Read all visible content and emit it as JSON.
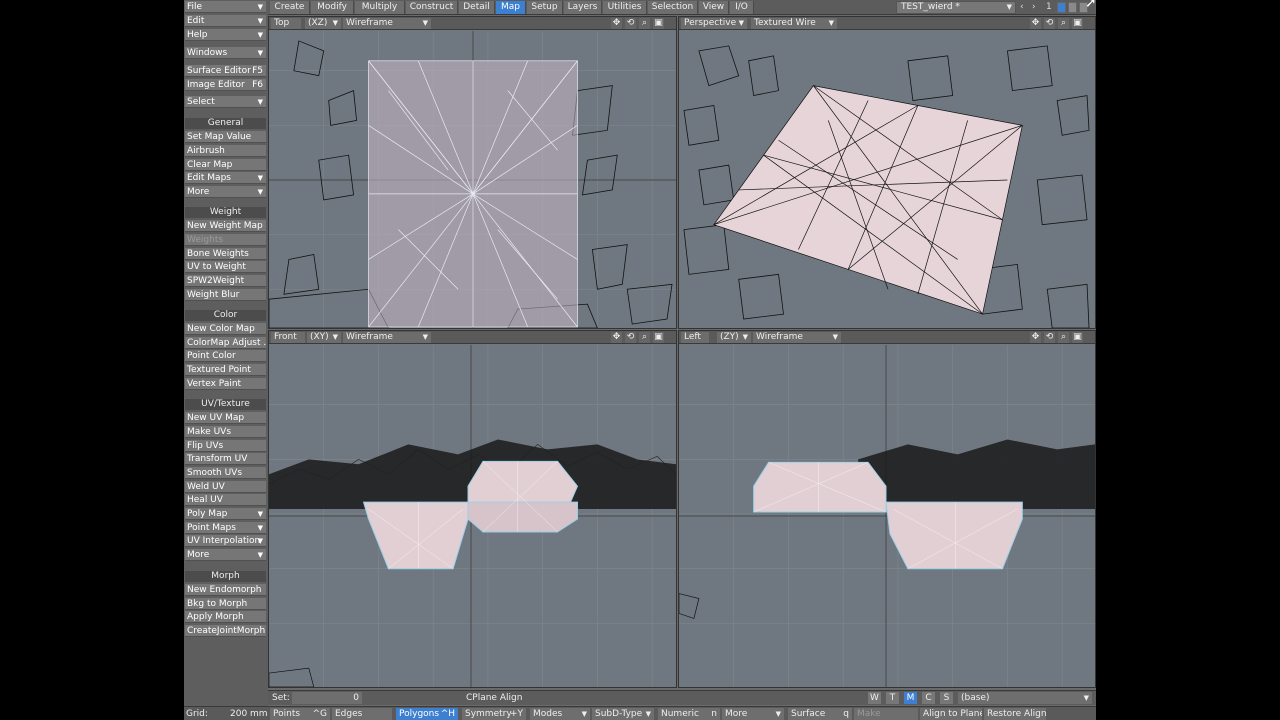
{
  "app": {
    "tabs": [
      "Create",
      "Modify",
      "Multiply",
      "Construct",
      "Detail",
      "Map",
      "Setup",
      "Layers",
      "Utilities",
      "Selection",
      "View",
      "I/O"
    ],
    "active_tab": "Map",
    "object_name": "TEST_wierd *",
    "layer_number": "1"
  },
  "sidebar": {
    "file": "File",
    "edit": "Edit",
    "help": "Help",
    "windows": "Windows",
    "surface_editor": "Surface Editor",
    "surface_editor_key": "F5",
    "image_editor": "Image Editor",
    "image_editor_key": "F6",
    "select": "Select",
    "general_header": "General",
    "set_map_value": "Set Map Value",
    "airbrush": "Airbrush",
    "clear_map": "Clear Map",
    "edit_maps": "Edit Maps",
    "more1": "More",
    "weight_header": "Weight",
    "new_weight_map": "New Weight Map",
    "weights": "Weights",
    "bone_weights": "Bone Weights",
    "uv_to_weight": "UV to Weight",
    "spw2weight": "SPW2Weight",
    "weight_blur": "Weight Blur",
    "color_header": "Color",
    "new_color_map": "New Color Map",
    "colormap_adjust": "ColorMap Adjust ...",
    "point_color": "Point Color",
    "textured_point": "Textured Point",
    "vertex_paint": "Vertex Paint",
    "uvtexture_header": "UV/Texture",
    "new_uv_map": "New UV Map",
    "make_uvs": "Make UVs",
    "flip_uvs": "Flip UVs",
    "transform_uv": "Transform UV",
    "smooth_uvs": "Smooth UVs",
    "weld_uv": "Weld UV",
    "heal_uv": "Heal UV",
    "poly_map": "Poly Map",
    "point_maps": "Point Maps",
    "uv_interpolation": "UV Interpolation",
    "more2": "More",
    "morph_header": "Morph",
    "new_endomorph": "New Endomorph",
    "bkg_to_morph": "Bkg to Morph",
    "apply_morph": "Apply Morph",
    "create_joint_morph": "CreateJointMorph"
  },
  "viewports": {
    "top": {
      "view": "Top",
      "axis": "(XZ)",
      "mode": "Wireframe"
    },
    "perspective": {
      "view": "Perspective",
      "mode": "Textured Wire"
    },
    "front": {
      "view": "Front",
      "axis": "(XY)",
      "mode": "Wireframe"
    },
    "left": {
      "view": "Left",
      "axis": "(ZY)",
      "mode": "Wireframe"
    }
  },
  "status": {
    "set_label": "Set:",
    "set_value": "0",
    "message": "CPlane Align",
    "w": "W",
    "t": "T",
    "m": "M",
    "c": "C",
    "s": "S",
    "layer_base": "(base)"
  },
  "bottom": {
    "grid_label": "Grid:",
    "grid_value": "200 mm",
    "points": "Points",
    "points_key": "^G",
    "edges": "Edges",
    "polygons": "Polygons",
    "polygons_key": "^H",
    "symmetry": "Symmetry",
    "symmetry_key": "+Y",
    "modes": "Modes",
    "subd_type": "SubD-Type",
    "numeric": "Numeric",
    "numeric_key": "n",
    "more": "More",
    "surface": "Surface",
    "surface_key": "q",
    "make": "Make",
    "align_to_plane": "Align to Plane",
    "restore_align": "Restore Align"
  }
}
